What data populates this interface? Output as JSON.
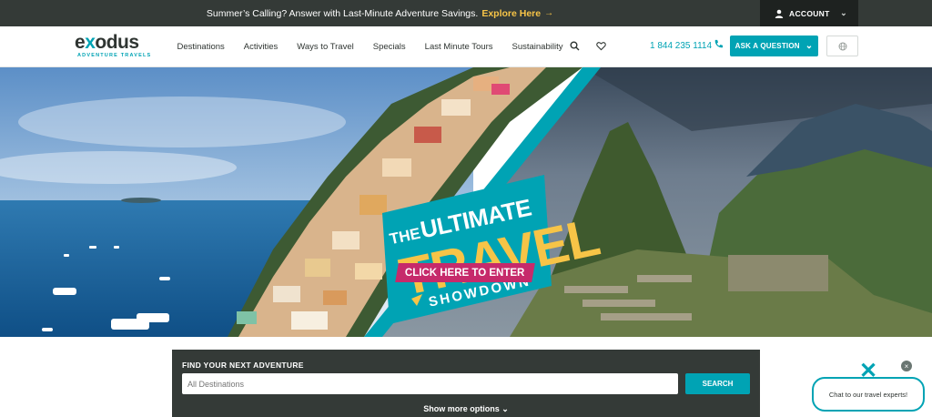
{
  "promo": {
    "text": "Summer’s Calling? Answer with Last-Minute Adventure Savings.",
    "link": "Explore Here",
    "arrow": "→"
  },
  "account": {
    "label": "ACCOUNT",
    "icon": "user-icon"
  },
  "header": {
    "logo_word_pre": "e",
    "logo_word_x": "x",
    "logo_word_post": "odus",
    "logo_tagline": "ADVENTURE TRAVELS",
    "nav": [
      "Destinations",
      "Activities",
      "Ways to Travel",
      "Specials",
      "Last Minute Tours",
      "Sustainability"
    ],
    "phone": "1 844 235 1114",
    "ask_button": "ASK A QUESTION",
    "icons": {
      "search": "search-icon",
      "wishlist": "heart-icon",
      "phone": "phone-icon",
      "language": "globe-icon"
    }
  },
  "hero": {
    "the": "THE",
    "ultimate": "ULTIMATE",
    "travel": "TRAVEL",
    "showdown": "SHOWDOWN",
    "cta": "CLICK HERE TO ENTER"
  },
  "search": {
    "title": "FIND YOUR NEXT ADVENTURE",
    "placeholder": "All Destinations",
    "button": "SEARCH",
    "more": "Show more options"
  },
  "chat": {
    "label": "Chat to our travel experts!"
  },
  "colors": {
    "accent": "#00a3b4",
    "dark": "#343a37",
    "yellow": "#f7c447",
    "magenta": "#c62a6b"
  }
}
